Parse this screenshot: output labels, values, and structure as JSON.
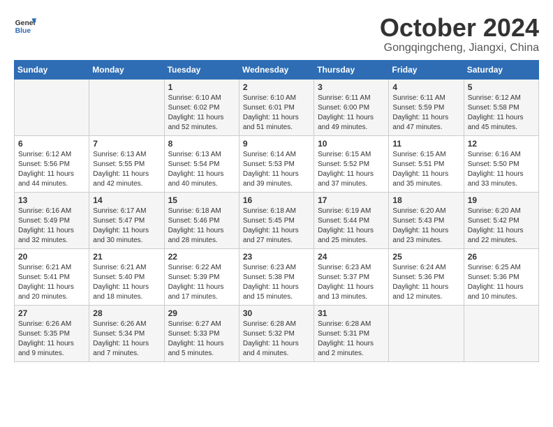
{
  "header": {
    "logo_line1": "General",
    "logo_line2": "Blue",
    "month_title": "October 2024",
    "location": "Gongqingcheng, Jiangxi, China"
  },
  "days_of_week": [
    "Sunday",
    "Monday",
    "Tuesday",
    "Wednesday",
    "Thursday",
    "Friday",
    "Saturday"
  ],
  "weeks": [
    [
      {
        "day": "",
        "info": ""
      },
      {
        "day": "",
        "info": ""
      },
      {
        "day": "1",
        "info": "Sunrise: 6:10 AM\nSunset: 6:02 PM\nDaylight: 11 hours and 52 minutes."
      },
      {
        "day": "2",
        "info": "Sunrise: 6:10 AM\nSunset: 6:01 PM\nDaylight: 11 hours and 51 minutes."
      },
      {
        "day": "3",
        "info": "Sunrise: 6:11 AM\nSunset: 6:00 PM\nDaylight: 11 hours and 49 minutes."
      },
      {
        "day": "4",
        "info": "Sunrise: 6:11 AM\nSunset: 5:59 PM\nDaylight: 11 hours and 47 minutes."
      },
      {
        "day": "5",
        "info": "Sunrise: 6:12 AM\nSunset: 5:58 PM\nDaylight: 11 hours and 45 minutes."
      }
    ],
    [
      {
        "day": "6",
        "info": "Sunrise: 6:12 AM\nSunset: 5:56 PM\nDaylight: 11 hours and 44 minutes."
      },
      {
        "day": "7",
        "info": "Sunrise: 6:13 AM\nSunset: 5:55 PM\nDaylight: 11 hours and 42 minutes."
      },
      {
        "day": "8",
        "info": "Sunrise: 6:13 AM\nSunset: 5:54 PM\nDaylight: 11 hours and 40 minutes."
      },
      {
        "day": "9",
        "info": "Sunrise: 6:14 AM\nSunset: 5:53 PM\nDaylight: 11 hours and 39 minutes."
      },
      {
        "day": "10",
        "info": "Sunrise: 6:15 AM\nSunset: 5:52 PM\nDaylight: 11 hours and 37 minutes."
      },
      {
        "day": "11",
        "info": "Sunrise: 6:15 AM\nSunset: 5:51 PM\nDaylight: 11 hours and 35 minutes."
      },
      {
        "day": "12",
        "info": "Sunrise: 6:16 AM\nSunset: 5:50 PM\nDaylight: 11 hours and 33 minutes."
      }
    ],
    [
      {
        "day": "13",
        "info": "Sunrise: 6:16 AM\nSunset: 5:49 PM\nDaylight: 11 hours and 32 minutes."
      },
      {
        "day": "14",
        "info": "Sunrise: 6:17 AM\nSunset: 5:47 PM\nDaylight: 11 hours and 30 minutes."
      },
      {
        "day": "15",
        "info": "Sunrise: 6:18 AM\nSunset: 5:46 PM\nDaylight: 11 hours and 28 minutes."
      },
      {
        "day": "16",
        "info": "Sunrise: 6:18 AM\nSunset: 5:45 PM\nDaylight: 11 hours and 27 minutes."
      },
      {
        "day": "17",
        "info": "Sunrise: 6:19 AM\nSunset: 5:44 PM\nDaylight: 11 hours and 25 minutes."
      },
      {
        "day": "18",
        "info": "Sunrise: 6:20 AM\nSunset: 5:43 PM\nDaylight: 11 hours and 23 minutes."
      },
      {
        "day": "19",
        "info": "Sunrise: 6:20 AM\nSunset: 5:42 PM\nDaylight: 11 hours and 22 minutes."
      }
    ],
    [
      {
        "day": "20",
        "info": "Sunrise: 6:21 AM\nSunset: 5:41 PM\nDaylight: 11 hours and 20 minutes."
      },
      {
        "day": "21",
        "info": "Sunrise: 6:21 AM\nSunset: 5:40 PM\nDaylight: 11 hours and 18 minutes."
      },
      {
        "day": "22",
        "info": "Sunrise: 6:22 AM\nSunset: 5:39 PM\nDaylight: 11 hours and 17 minutes."
      },
      {
        "day": "23",
        "info": "Sunrise: 6:23 AM\nSunset: 5:38 PM\nDaylight: 11 hours and 15 minutes."
      },
      {
        "day": "24",
        "info": "Sunrise: 6:23 AM\nSunset: 5:37 PM\nDaylight: 11 hours and 13 minutes."
      },
      {
        "day": "25",
        "info": "Sunrise: 6:24 AM\nSunset: 5:36 PM\nDaylight: 11 hours and 12 minutes."
      },
      {
        "day": "26",
        "info": "Sunrise: 6:25 AM\nSunset: 5:36 PM\nDaylight: 11 hours and 10 minutes."
      }
    ],
    [
      {
        "day": "27",
        "info": "Sunrise: 6:26 AM\nSunset: 5:35 PM\nDaylight: 11 hours and 9 minutes."
      },
      {
        "day": "28",
        "info": "Sunrise: 6:26 AM\nSunset: 5:34 PM\nDaylight: 11 hours and 7 minutes."
      },
      {
        "day": "29",
        "info": "Sunrise: 6:27 AM\nSunset: 5:33 PM\nDaylight: 11 hours and 5 minutes."
      },
      {
        "day": "30",
        "info": "Sunrise: 6:28 AM\nSunset: 5:32 PM\nDaylight: 11 hours and 4 minutes."
      },
      {
        "day": "31",
        "info": "Sunrise: 6:28 AM\nSunset: 5:31 PM\nDaylight: 11 hours and 2 minutes."
      },
      {
        "day": "",
        "info": ""
      },
      {
        "day": "",
        "info": ""
      }
    ]
  ]
}
